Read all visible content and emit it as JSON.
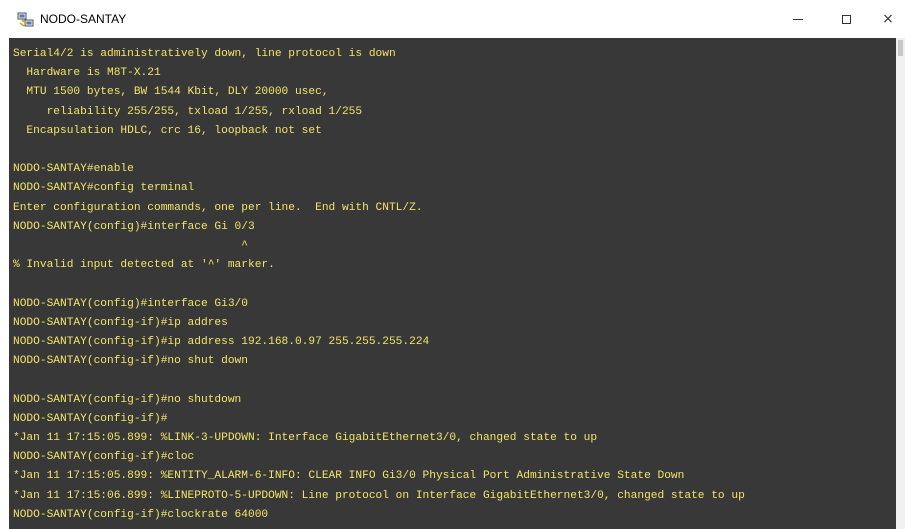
{
  "window": {
    "title": "NODO-SANTAY",
    "icon": "putty-terminal-icon",
    "controls": {
      "minimize": "minimize-icon",
      "maximize": "maximize-icon",
      "close": "×"
    }
  },
  "terminal": {
    "text_color": "#f2e46a",
    "background": "#383838",
    "lines": [
      "Serial4/2 is administratively down, line protocol is down",
      "  Hardware is M8T-X.21",
      "  MTU 1500 bytes, BW 1544 Kbit, DLY 20000 usec,",
      "     reliability 255/255, txload 1/255, rxload 1/255",
      "  Encapsulation HDLC, crc 16, loopback not set",
      "",
      "NODO-SANTAY#enable",
      "NODO-SANTAY#config terminal",
      "Enter configuration commands, one per line.  End with CNTL/Z.",
      "NODO-SANTAY(config)#interface Gi 0/3",
      "                                  ^",
      "% Invalid input detected at '^' marker.",
      "",
      "NODO-SANTAY(config)#interface Gi3/0",
      "NODO-SANTAY(config-if)#ip addres",
      "NODO-SANTAY(config-if)#ip address 192.168.0.97 255.255.255.224",
      "NODO-SANTAY(config-if)#no shut down",
      "",
      "NODO-SANTAY(config-if)#no shutdown",
      "NODO-SANTAY(config-if)#",
      "*Jan 11 17:15:05.899: %LINK-3-UPDOWN: Interface GigabitEthernet3/0, changed state to up",
      "NODO-SANTAY(config-if)#cloc",
      "*Jan 11 17:15:05.899: %ENTITY_ALARM-6-INFO: CLEAR INFO Gi3/0 Physical Port Administrative State Down",
      "*Jan 11 17:15:06.899: %LINEPROTO-5-UPDOWN: Line protocol on Interface GigabitEthernet3/0, changed state to up",
      "NODO-SANTAY(config-if)#clockrate 64000"
    ]
  }
}
